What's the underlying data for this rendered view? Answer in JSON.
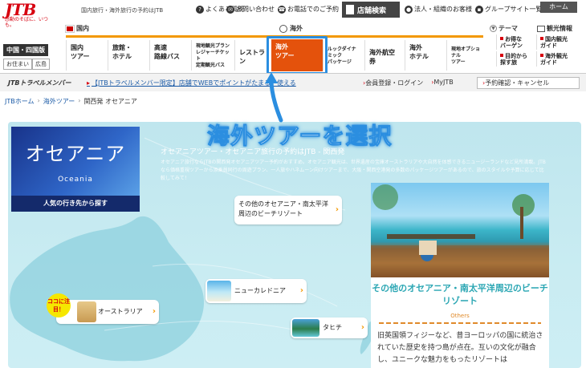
{
  "header": {
    "logo_text": "JTB",
    "logo_tagline": "感動のそばに、いつも。",
    "tagline": "国内旅行・海外旅行の予約はJTB",
    "util_links": [
      "よくある質問",
      "お問い合わせ",
      "お電話でのご予約"
    ],
    "store_search": "店舗検索",
    "corporate_link": "法人・組織のお客様",
    "group_sites": "グループサイト一覧",
    "home": "ホーム"
  },
  "area": {
    "name": "中国・四国版",
    "residence_label": "お住まい",
    "residence_value": "広島"
  },
  "nav": {
    "domestic_tab": "国内",
    "overseas_tab": "海外",
    "theme_label": "テーマ",
    "tourism_label": "観光情報",
    "items": [
      {
        "label1": "国内",
        "label2": "ツアー"
      },
      {
        "label1": "旅館・",
        "label2": "ホテル"
      },
      {
        "label1": "高速",
        "label2": "路線バス"
      },
      {
        "label1": "現地観光プラン",
        "label2": "レジャーチケット",
        "label3": "定期観光バス"
      },
      {
        "label1": "レストラン",
        "label2": ""
      },
      {
        "label1": "海外",
        "label2": "ツアー"
      },
      {
        "label1": "ルックダイナミック",
        "label2": "パッケージ"
      },
      {
        "label1": "海外航空券",
        "label2": ""
      },
      {
        "label1": "海外",
        "label2": "ホテル"
      },
      {
        "label1": "現地オプショナル",
        "label2": "ツアー"
      }
    ],
    "side_items": [
      {
        "label1": "お得な",
        "label2": "バーゲン"
      },
      {
        "label1": "目的から",
        "label2": "探す旅"
      },
      {
        "label1": "国内観光",
        "label2": "ガイド"
      },
      {
        "label1": "海外観光",
        "label2": "ガイド"
      }
    ]
  },
  "member": {
    "logo": "JTBトラベルメンバー",
    "promo": "【JTBトラベルメンバー限定】店舗でWEBでポイントがたまる・使える",
    "links": [
      "会員登録・ログイン",
      "MyJTB"
    ],
    "reserve": "予約確認・キャンセル"
  },
  "breadcrumb": [
    "JTBホーム",
    "海外ツアー",
    "関西発 オセアニア"
  ],
  "hero": {
    "region_jp": "オセアニア",
    "region_en": "Oceania",
    "popular_button": "人気の行き先から探す",
    "title": "オセアニアツアー・オセアニア旅行の予約はJTB - 関西発",
    "description": "オセアニア旅行ならJTBの関西発オセアニアツアー予約がおすすめ。オセアニア観光は、世界遺産の宝庫オーストラリアや大自然を体感できるニュージーランドなど見所満載。JTBなら価格重視ツアーから添乗員同行の周遊プラン、一人旅やハネムーン向けツアーまで、大阪・関西空港発の多数のパッケージツアーがあるので、旅のスタイルや予算に応じて比較してみて！",
    "badge": "ココに注目！",
    "destinations": {
      "pacific": "その他のオセアニア・南太平洋周辺のビーチリゾート",
      "new_caledonia": "ニューカレドニア",
      "australia": "オーストラリア",
      "tahiti": "タヒチ"
    },
    "feature": {
      "title": "その他のオセアニア・南太平洋周辺のビーチリゾート",
      "subtitle": "Others",
      "text": "旧英国領フィジーなど、昔ヨーロッパの国に統治されていた歴史を持つ島が点在。互いの文化が融合し、ユニークな魅力をもったリゾートは"
    }
  },
  "annotation": "海外ツアーを選択",
  "colors": {
    "brand_red": "#d7000f",
    "nav_active": "#e4520c",
    "accent_orange": "#f39800",
    "annotation_blue": "#2b8ee0",
    "feature_teal": "#2aa6b3"
  }
}
